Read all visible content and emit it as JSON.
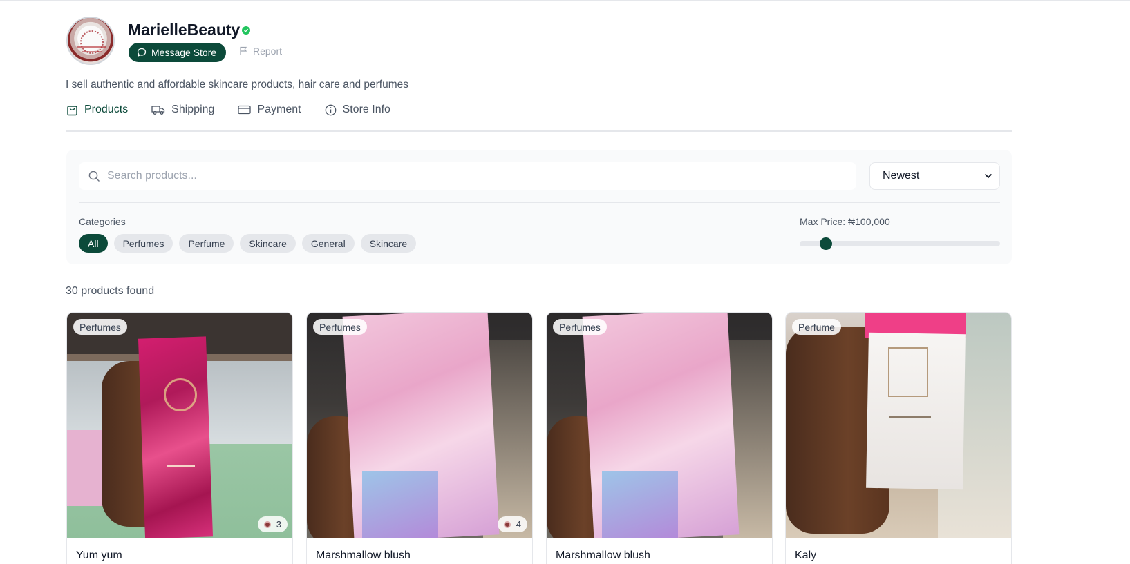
{
  "store": {
    "name": "MarielleBeauty",
    "message_label": "Message Store",
    "report_label": "Report",
    "bio": "I sell authentic and affordable skincare products, hair care and perfumes"
  },
  "tabs": [
    {
      "label": "Products",
      "icon": "bag-icon",
      "active": true
    },
    {
      "label": "Shipping",
      "icon": "truck-icon",
      "active": false
    },
    {
      "label": "Payment",
      "icon": "card-icon",
      "active": false
    },
    {
      "label": "Store Info",
      "icon": "info-icon",
      "active": false
    }
  ],
  "filters": {
    "search_placeholder": "Search products...",
    "sort_selected": "Newest",
    "categories_label": "Categories",
    "categories": [
      "All",
      "Perfumes",
      "Perfume",
      "Skincare",
      "General",
      "Skincare"
    ],
    "active_category": "All",
    "max_price_label": "Max Price: ₦100,000",
    "price_slider_fraction": 0.13
  },
  "results": {
    "count_label": "30 products found"
  },
  "products": [
    {
      "title": "Yum yum",
      "category": "Perfumes",
      "views": "3"
    },
    {
      "title": "Marshmallow blush",
      "category": "Perfumes",
      "views": "4"
    },
    {
      "title": "Marshmallow blush",
      "category": "Perfumes",
      "views": ""
    },
    {
      "title": "Kaly",
      "category": "Perfume",
      "views": ""
    }
  ],
  "colors": {
    "brand": "#0c4a3a",
    "verified": "#22c55e",
    "panel_bg": "#f9fafb"
  }
}
